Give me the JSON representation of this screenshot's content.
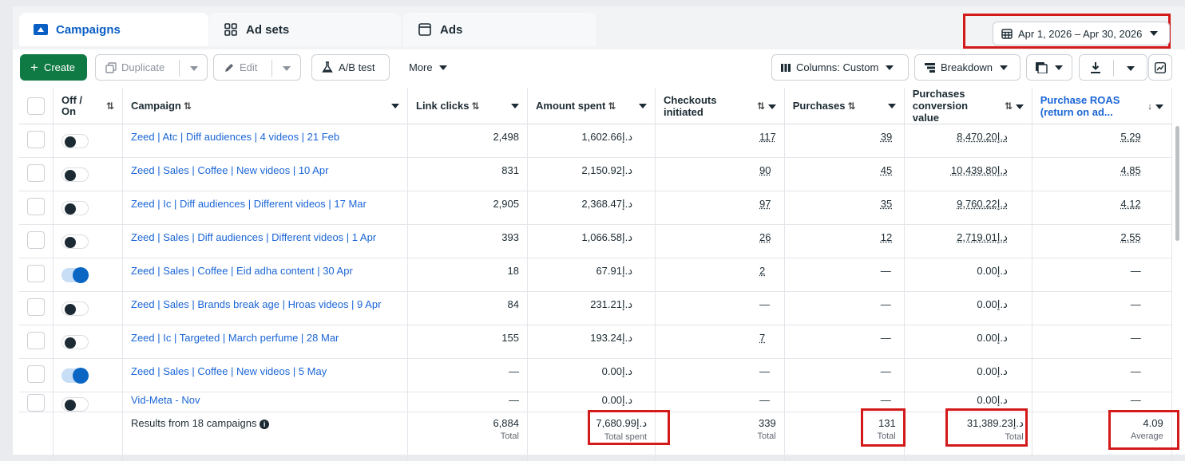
{
  "tabs": [
    {
      "label": "Campaigns",
      "icon": "campaign-folder-icon"
    },
    {
      "label": "Ad sets",
      "icon": "grid-icon"
    },
    {
      "label": "Ads",
      "icon": "ad-square-icon"
    }
  ],
  "date_range": {
    "label": "Apr 1, 2026 – Apr 30, 2026",
    "icon": "calendar-icon"
  },
  "toolbar": {
    "create_label": "Create",
    "duplicate_label": "Duplicate",
    "edit_label": "Edit",
    "ab_test_label": "A/B test",
    "more_label": "More",
    "columns_label": "Columns: Custom",
    "breakdown_label": "Breakdown"
  },
  "columns": {
    "onoff": "Off / On",
    "campaign": "Campaign",
    "link_clicks": "Link clicks",
    "amount_spent": "Amount spent",
    "checkouts": "Checkouts initiated",
    "purchases": "Purchases",
    "purchases_value": "Purchases conversion value",
    "roas": "Purchase ROAS (return on ad..."
  },
  "rows": [
    {
      "name": "Zeed | Atc | Diff audiences | 4 videos | 21 Feb",
      "on": false,
      "link_clicks": "2,498",
      "amount_spent": "د.إ1,602.66",
      "checkouts": "117",
      "purchases": "39",
      "value": "د.إ8,470.20",
      "roas": "5.29"
    },
    {
      "name": "Zeed | Sales | Coffee | New videos | 10 Apr",
      "on": false,
      "link_clicks": "831",
      "amount_spent": "د.إ2,150.92",
      "checkouts": "90",
      "purchases": "45",
      "value": "د.إ10,439.80",
      "roas": "4.85"
    },
    {
      "name": "Zeed | Ic | Diff audiences | Different videos | 17 Mar",
      "on": false,
      "link_clicks": "2,905",
      "amount_spent": "د.إ2,368.47",
      "checkouts": "97",
      "purchases": "35",
      "value": "د.إ9,760.22",
      "roas": "4.12"
    },
    {
      "name": "Zeed | Sales | Diff audiences | Different videos | 1 Apr",
      "on": false,
      "link_clicks": "393",
      "amount_spent": "د.إ1,066.58",
      "checkouts": "26",
      "purchases": "12",
      "value": "د.إ2,719.01",
      "roas": "2.55"
    },
    {
      "name": "Zeed | Sales | Coffee | Eid adha content | 30 Apr",
      "on": true,
      "link_clicks": "18",
      "amount_spent": "د.إ67.91",
      "checkouts": "2",
      "purchases": "—",
      "value": "د.إ0.00",
      "roas": "—"
    },
    {
      "name": "Zeed | Sales | Brands break age | Hroas videos | 9 Apr",
      "on": false,
      "link_clicks": "84",
      "amount_spent": "د.إ231.21",
      "checkouts": "—",
      "purchases": "—",
      "value": "د.إ0.00",
      "roas": "—"
    },
    {
      "name": "Zeed | Ic | Targeted | March perfume | 28 Mar",
      "on": false,
      "link_clicks": "155",
      "amount_spent": "د.إ193.24",
      "checkouts": "7",
      "purchases": "—",
      "value": "د.إ0.00",
      "roas": "—"
    },
    {
      "name": "Zeed | Sales | Coffee | New videos | 5 May",
      "on": true,
      "link_clicks": "—",
      "amount_spent": "د.إ0.00",
      "checkouts": "—",
      "purchases": "—",
      "value": "د.إ0.00",
      "roas": "—"
    },
    {
      "name": "Vid-Meta - Nov",
      "on": false,
      "link_clicks": "—",
      "amount_spent": "د.إ0.00",
      "checkouts": "—",
      "purchases": "—",
      "value": "د.إ0.00",
      "roas": "—"
    }
  ],
  "footer": {
    "results_label": "Results from 18 campaigns",
    "link_clicks": "6,884",
    "link_clicks_sub": "Total",
    "amount_spent": "د.إ7,680.99",
    "amount_spent_sub": "Total spent",
    "checkouts": "339",
    "checkouts_sub": "Total",
    "purchases": "131",
    "purchases_sub": "Total",
    "value": "د.إ31,389.23",
    "value_sub": "Total",
    "roas": "4.09",
    "roas_sub": "Average"
  },
  "colors": {
    "accent": "#0a5fc4",
    "create_green": "#0f7a43",
    "highlight_red": "#d4191a",
    "link_blue": "#1a65d6"
  }
}
